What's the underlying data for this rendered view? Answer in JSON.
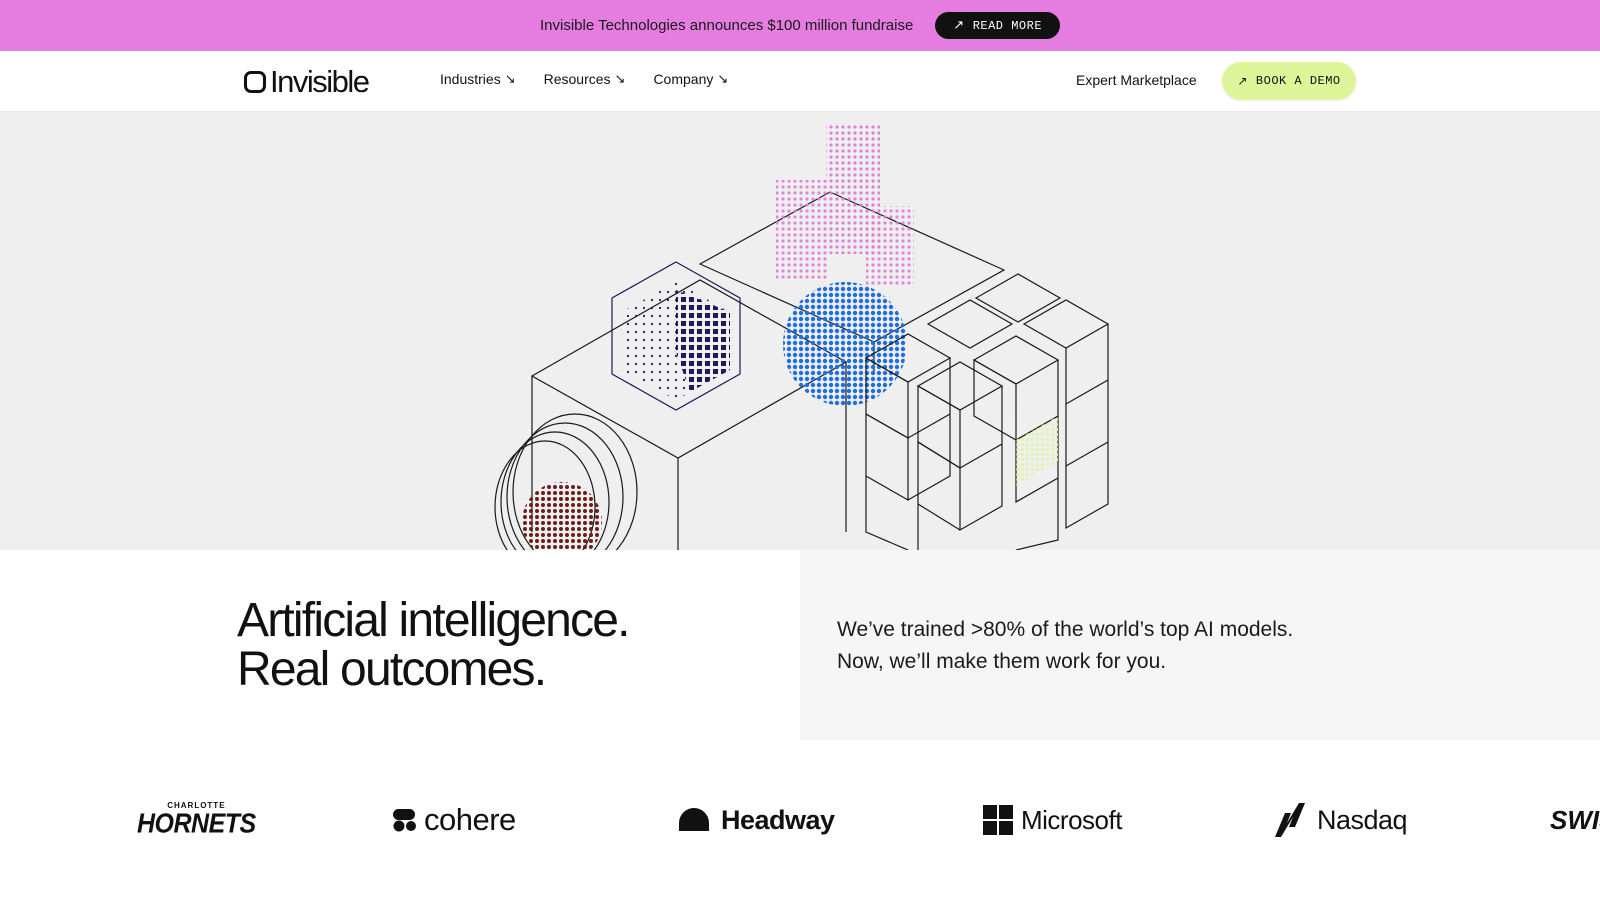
{
  "announcement": {
    "text": "Invisible Technologies announces $100 million fundraise",
    "button_label": "READ MORE",
    "button_icon": "arrow-up-right-icon"
  },
  "nav": {
    "logo_text": "Invisible",
    "items": [
      {
        "label": "Industries",
        "icon": "arrow-down-right-icon"
      },
      {
        "label": "Resources",
        "icon": "arrow-down-right-icon"
      },
      {
        "label": "Company",
        "icon": "arrow-down-right-icon"
      }
    ],
    "expert_link": "Expert Marketplace",
    "cta_label": "BOOK A DEMO",
    "cta_icon": "arrow-up-right-icon"
  },
  "hero": {
    "headline_line1": "Artificial intelligence.",
    "headline_line2": "Real outcomes.",
    "subcopy_line1": "We’ve trained >80% of the world’s top AI models.",
    "subcopy_line2": "Now, we’ll make them work for you."
  },
  "logos": {
    "hornets_small": "CHARLOTTE",
    "hornets_big": "HORNETS",
    "cohere": "cohere",
    "headway": "Headway",
    "microsoft": "Microsoft",
    "nasdaq": "Nasdaq",
    "swiss": "SWIS"
  },
  "colors": {
    "announcement_bg": "#e57de0",
    "cta_bg": "#dff59a",
    "hero_bg": "#efefef"
  }
}
